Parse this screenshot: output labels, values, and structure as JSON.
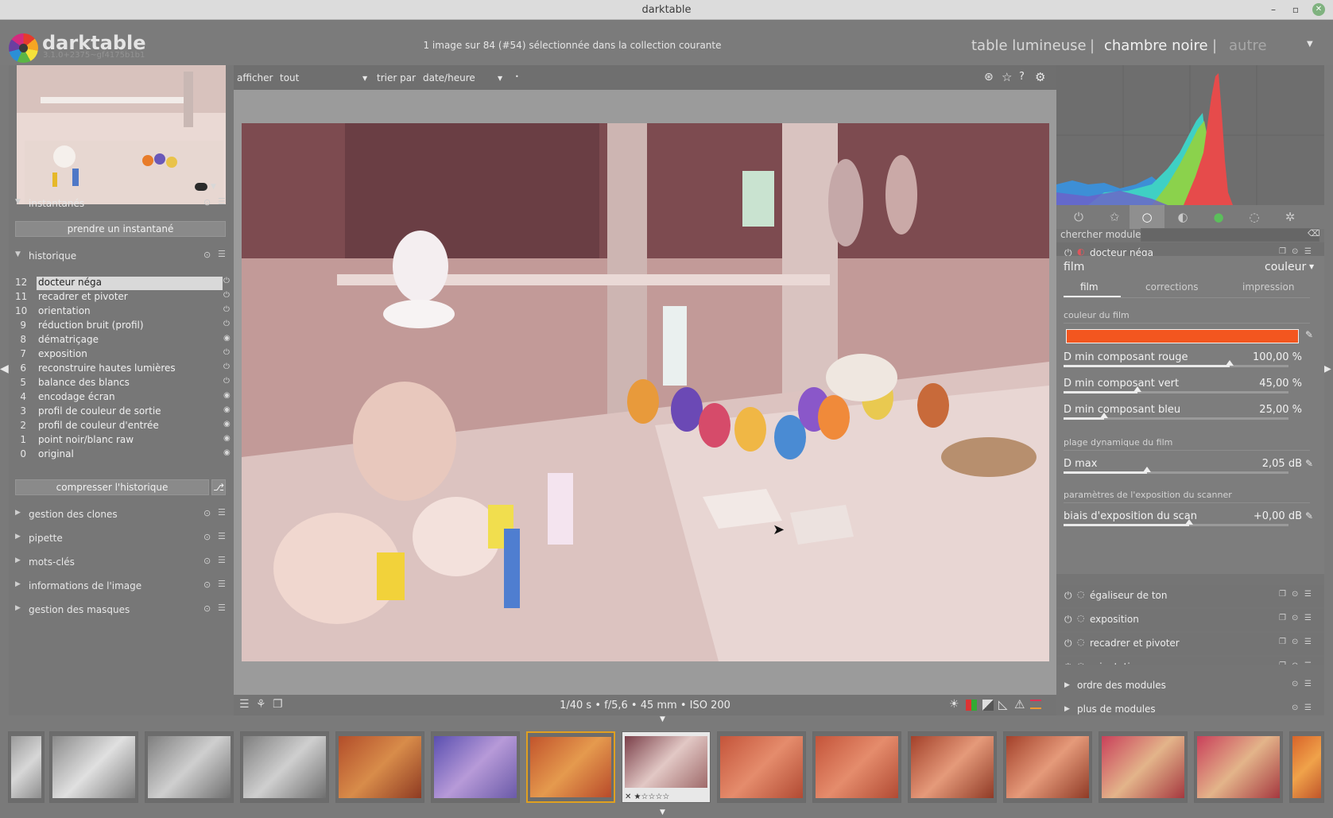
{
  "window": {
    "title": "darktable"
  },
  "header": {
    "app_name": "darktable",
    "version": "3.1.0+2375~gf4175b1b1",
    "info": "1 image sur 84 (#54) sélectionnée dans la collection courante",
    "views": {
      "lighttable": "table lumineuse",
      "sep1": "|",
      "darkroom": "chambre noire",
      "sep2": "|",
      "other": "autre"
    }
  },
  "left_panel": {
    "snapshots": {
      "label": "instantanés",
      "button": "prendre un instantané"
    },
    "history": {
      "label": "historique",
      "items": [
        {
          "n": "12",
          "label": "docteur néga"
        },
        {
          "n": "11",
          "label": "recadrer et pivoter"
        },
        {
          "n": "10",
          "label": "orientation"
        },
        {
          "n": "9",
          "label": "réduction bruit (profil)"
        },
        {
          "n": "8",
          "label": "dématriçage"
        },
        {
          "n": "7",
          "label": "exposition"
        },
        {
          "n": "6",
          "label": "reconstruire hautes lumières"
        },
        {
          "n": "5",
          "label": "balance des blancs"
        },
        {
          "n": "4",
          "label": "encodage écran"
        },
        {
          "n": "3",
          "label": "profil de couleur de sortie"
        },
        {
          "n": "2",
          "label": "profil de couleur d'entrée"
        },
        {
          "n": "1",
          "label": "point noir/blanc raw"
        },
        {
          "n": "0",
          "label": "original"
        }
      ],
      "compress_button": "compresser l'historique"
    },
    "collapsed_sections": [
      "gestion des clones",
      "pipette",
      "mots-clés",
      "informations de l'image",
      "gestion des masques"
    ]
  },
  "topbar": {
    "show_label": "afficher",
    "show_value": "tout",
    "sort_label": "trier par",
    "sort_value": "date/heure"
  },
  "bottombar": {
    "exif": "1/40 s • f/5,6 • 45 mm • ISO 200"
  },
  "right_panel": {
    "search_label": "chercher module",
    "active_module": {
      "name": "docteur néga",
      "film_label": "film",
      "film_type": "couleur",
      "subtabs": [
        "film",
        "corrections",
        "impression"
      ],
      "film_color_label": "couleur du film",
      "film_color": "#f3561f",
      "sliders_dmin": [
        {
          "name": "D min composant rouge",
          "value": "100,00 %",
          "pct": 0.74
        },
        {
          "name": "D min composant vert",
          "value": "45,00 %",
          "pct": 0.33
        },
        {
          "name": "D min composant bleu",
          "value": "25,00 %",
          "pct": 0.18
        }
      ],
      "dynamic_range_label": "plage dynamique du film",
      "dmax": {
        "name": "D max",
        "value": "2,05 dB",
        "pct": 0.37
      },
      "scanner_label": "paramètres de l'exposition du scanner",
      "scan_bias": {
        "name": "biais d'exposition du scan",
        "value": "+0,00 dB",
        "pct": 0.56
      }
    },
    "other_modules": [
      "égaliseur de ton",
      "exposition",
      "recadrer et pivoter",
      "orientation"
    ],
    "footer_sections": [
      "ordre des modules",
      "plus de modules"
    ]
  }
}
